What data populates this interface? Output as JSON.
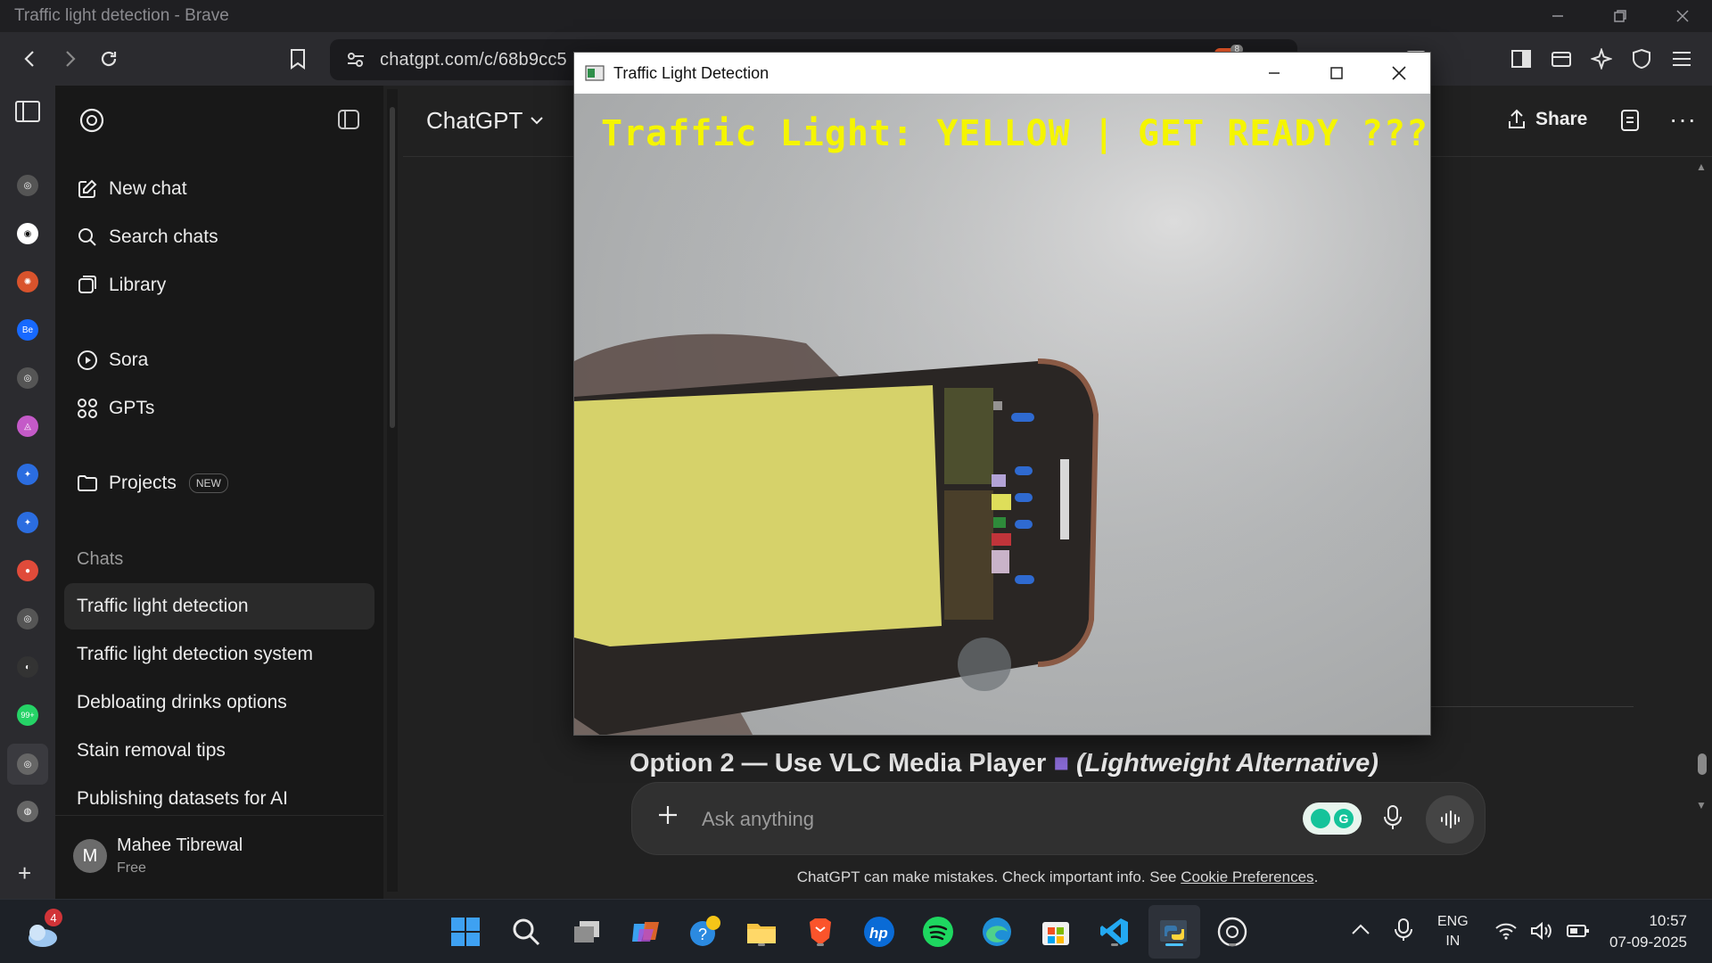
{
  "browser": {
    "window_title": "Traffic light detection - Brave",
    "url": "chatgpt.com/c/68b9cc5",
    "brave_badge": "8"
  },
  "sidebar": {
    "nav": [
      {
        "label": "New chat",
        "icon": "pencil-square-icon"
      },
      {
        "label": "Search chats",
        "icon": "search-icon"
      },
      {
        "label": "Library",
        "icon": "library-icon"
      },
      {
        "label": "Sora",
        "icon": "play-circle-icon"
      },
      {
        "label": "GPTs",
        "icon": "grid-dots-icon"
      },
      {
        "label": "Projects",
        "icon": "folder-icon"
      }
    ],
    "projects_badge": "NEW",
    "chats_heading": "Chats",
    "chats": [
      "Traffic light detection",
      "Traffic light detection system",
      "Debloating drinks options",
      "Stain removal tips",
      "Publishing datasets for AI"
    ],
    "user": {
      "initial": "M",
      "name": "Mahee Tibrewal",
      "plan": "Free"
    }
  },
  "header": {
    "model": "ChatGPT",
    "share_label": "Share"
  },
  "popup": {
    "title": "Traffic Light Detection",
    "overlay_text": "Traffic Light: YELLOW | GET READY ??????",
    "overlay_color": "#f5f500"
  },
  "content": {
    "option_heading_main": "Option 2 — Use VLC Media Player",
    "option_heading_italic": "(Lightweight Alternative)"
  },
  "composer": {
    "placeholder": "Ask anything"
  },
  "disclaimer": {
    "text": "ChatGPT can make mistakes. Check important info. See ",
    "link": "Cookie Preferences",
    "end": "."
  },
  "taskbar": {
    "weather_badge": "4",
    "lang_top": "ENG",
    "lang_bottom": "IN",
    "time": "10:57",
    "date": "07-09-2025"
  }
}
